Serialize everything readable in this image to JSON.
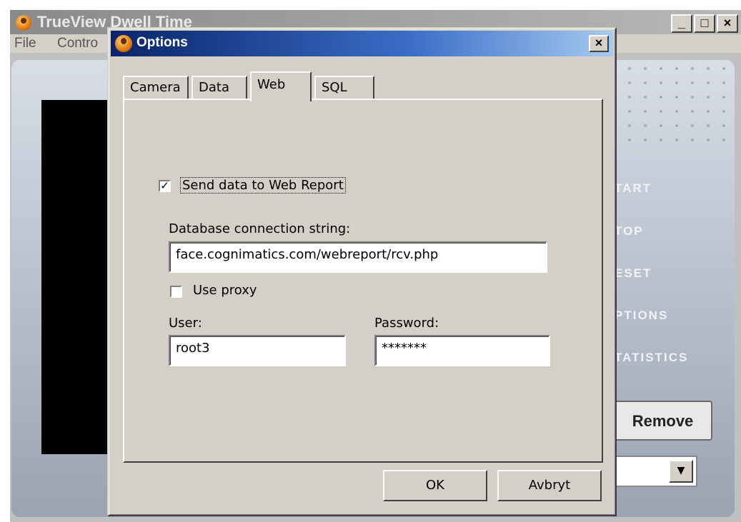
{
  "main_window": {
    "title": "TrueView Dwell Time",
    "window_buttons": [
      "_",
      "□",
      "×"
    ],
    "menu": [
      "File",
      "Contro"
    ],
    "side_menu": [
      "TART",
      "TOP",
      "ESET",
      "PTIONS",
      "TATISTICS"
    ],
    "remove_label": "Remove",
    "combo_arrow": "▼"
  },
  "dialog": {
    "title": "Options",
    "close": "×",
    "tabs": [
      "Camera",
      "Data",
      "Web",
      "SQL"
    ],
    "active_tab": "Web",
    "send_data": {
      "checked": true,
      "check_mark": "✓",
      "label": "Send data to Web Report"
    },
    "connection_label": "Database connection string:",
    "connection_value": "face.cognimatics.com/webreport/rcv.php",
    "proxy": {
      "checked": false,
      "label": "Use proxy"
    },
    "user_label": "User:",
    "user_value": "root3",
    "password_label": "Password:",
    "password_value": "*******",
    "ok_label": "OK",
    "cancel_label": "Avbryt"
  }
}
